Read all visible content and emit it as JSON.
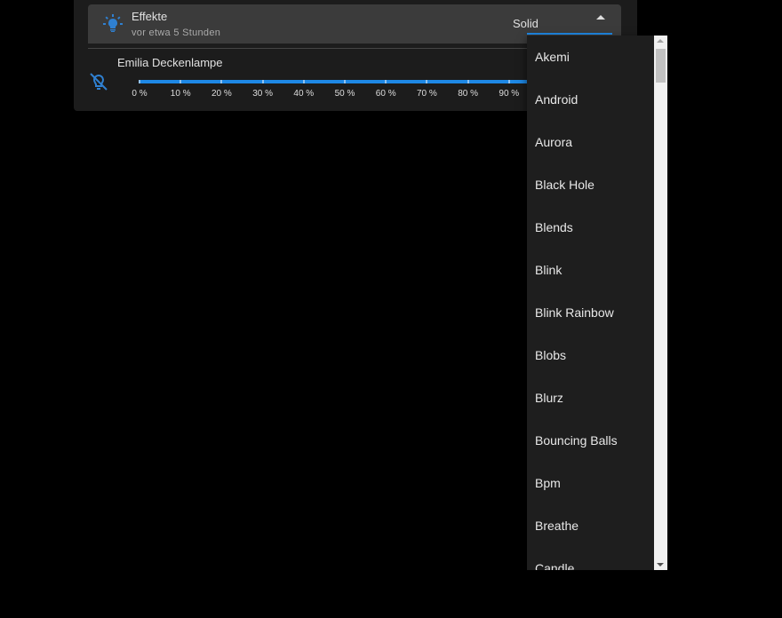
{
  "effects_row": {
    "title": "Effekte",
    "subtitle": "vor etwa 5 Stunden",
    "selected": "Solid",
    "icon": "lightbulb-on-icon"
  },
  "lamp_row": {
    "title": "Emilia Deckenlampe",
    "icon": "lightbulb-off-icon",
    "slider_value_percent": 100,
    "tick_labels": [
      "0 %",
      "10 %",
      "20 %",
      "30 %",
      "40 %",
      "50 %",
      "60 %",
      "70 %",
      "80 %",
      "90 %"
    ]
  },
  "dropdown": {
    "options": [
      "Akemi",
      "Android",
      "Aurora",
      "Black Hole",
      "Blends",
      "Blink",
      "Blink Rainbow",
      "Blobs",
      "Blurz",
      "Bouncing Balls",
      "Bpm",
      "Breathe",
      "Candle"
    ]
  },
  "colors": {
    "accent": "#1e88e5"
  }
}
